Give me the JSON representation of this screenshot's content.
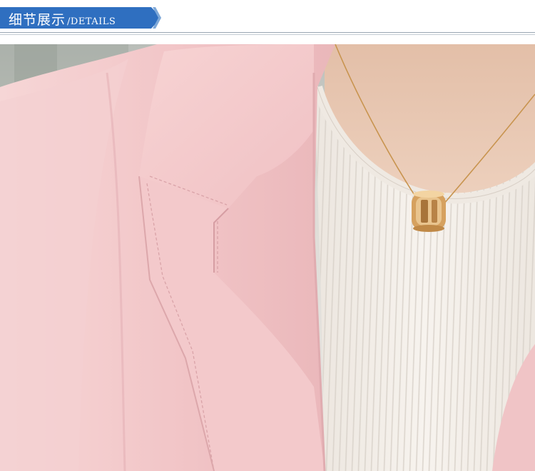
{
  "header": {
    "title_cn": "细节展示",
    "title_en": "/DETAILS",
    "banner_color": "#2f6fc0"
  },
  "photo": {
    "colors": {
      "blazer": "#f2c7c9",
      "sweater": "#f4efe9",
      "skin": "#e7c3ad",
      "gold": "#d7a25c",
      "background": "#d9d7d2"
    }
  }
}
